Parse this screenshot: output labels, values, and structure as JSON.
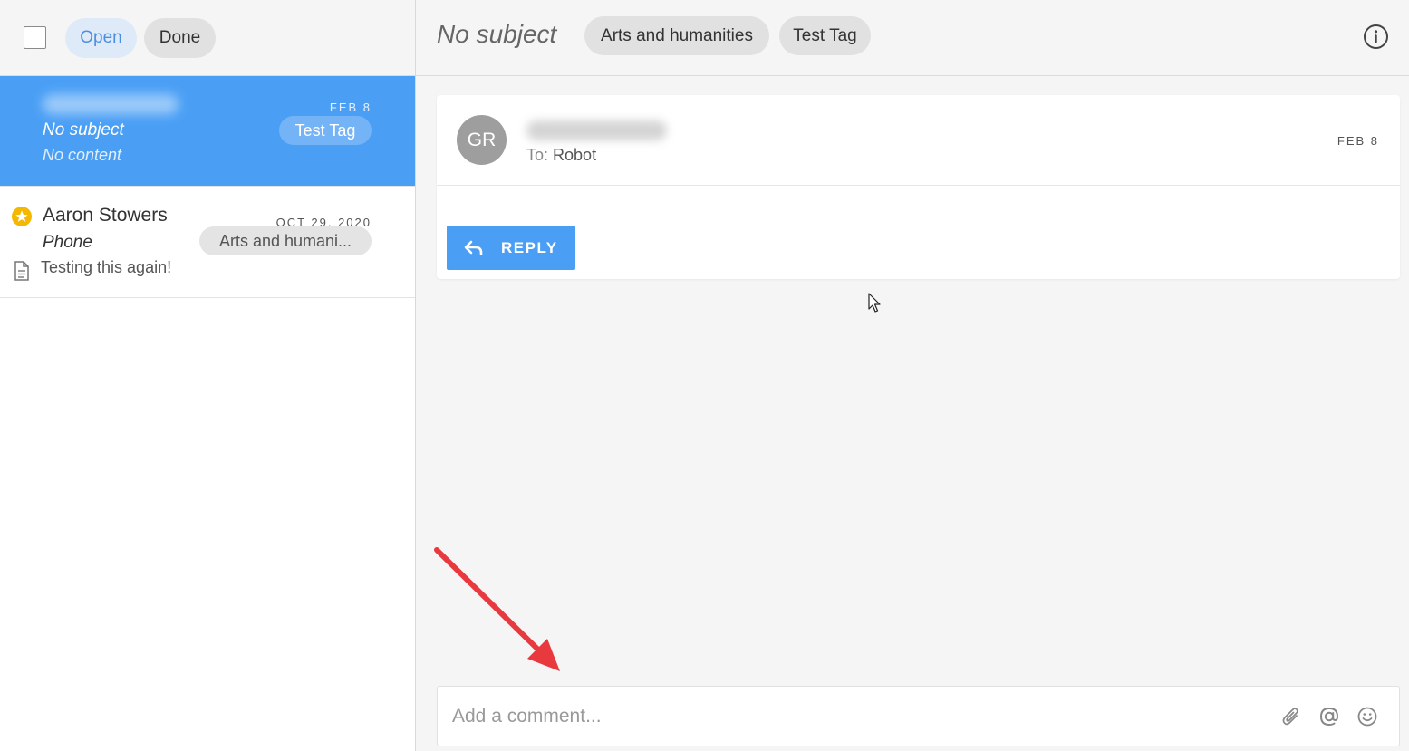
{
  "filters": {
    "open_label": "Open",
    "done_label": "Done"
  },
  "conversations": [
    {
      "date": "FEB 8",
      "subject": "No subject",
      "preview": "No content",
      "tag": "Test Tag"
    },
    {
      "sender": "Aaron Stowers",
      "date": "OCT 29, 2020",
      "subject": "Phone",
      "preview": "Testing this again!",
      "tag": "Arts and humani..."
    }
  ],
  "header": {
    "subject": "No subject",
    "tags": [
      "Arts and humanities",
      "Test Tag"
    ]
  },
  "message": {
    "avatar_initials": "GR",
    "to_label": "To:",
    "to_value": "Robot",
    "date": "FEB 8",
    "reply_label": "REPLY"
  },
  "comment": {
    "placeholder": "Add a comment..."
  },
  "colors": {
    "accent": "#4a9ff5",
    "annotation_arrow": "#e8393f",
    "star": "#f5b800"
  }
}
